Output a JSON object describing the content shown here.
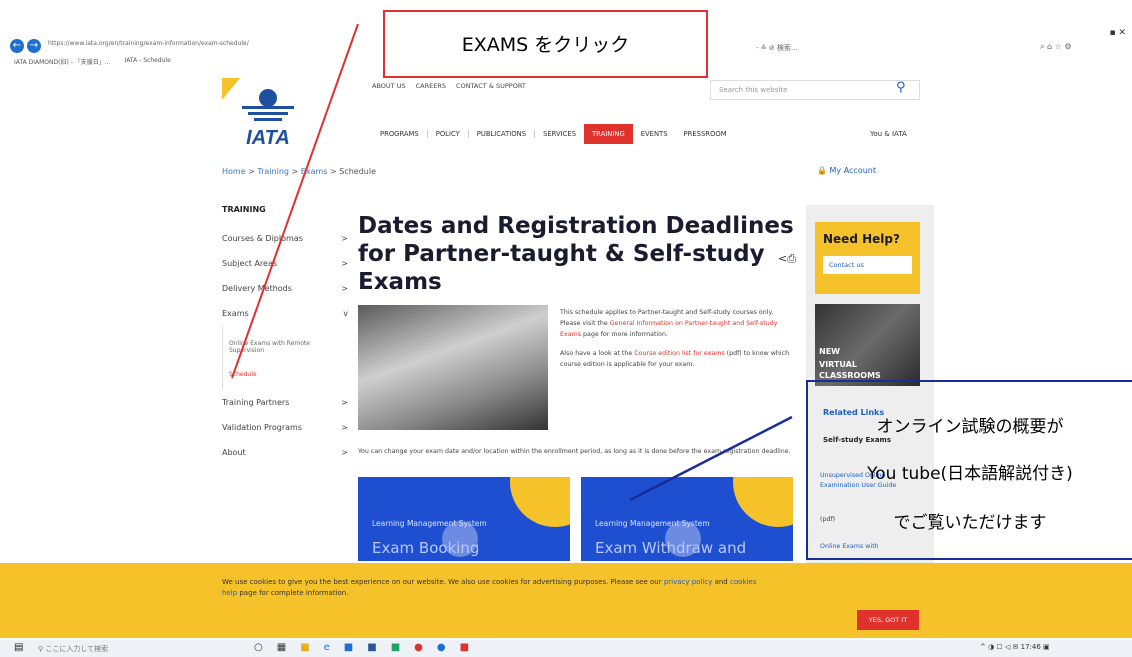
{
  "browser": {
    "url": "https://www.iata.org/en/training/exam-information/exam-schedule/",
    "tabs": [
      "IATA DIAMOND(旧) - 「支援日」...",
      "IATA - Schedule"
    ],
    "address_right": "- ≙ ⊘ 検索..."
  },
  "annotation": {
    "click_note": "EXAMS をクリック",
    "video_note": [
      "オンライン試験の概要が",
      "You tube(日本語解説付き)",
      "でご覧いただけます"
    ]
  },
  "header": {
    "top_links": [
      "ABOUT US",
      "CAREERS",
      "CONTACT & SUPPORT"
    ],
    "search_placeholder": "Search this website",
    "nav": [
      "PROGRAMS",
      "POLICY",
      "PUBLICATIONS",
      "SERVICES",
      "TRAINING",
      "EVENTS",
      "PRESSROOM"
    ],
    "you_iata": "You & IATA",
    "logo_text": "IATA"
  },
  "breadcrumb": {
    "home": "Home",
    "training": "Training",
    "exams": "Exams",
    "schedule": "Schedule",
    "sep": ">"
  },
  "my_account": "My Account",
  "sidebar": {
    "title": "TRAINING",
    "items": [
      {
        "label": "Courses & Diplomas",
        "chev": ">"
      },
      {
        "label": "Subject Areas",
        "chev": ">"
      },
      {
        "label": "Delivery Methods",
        "chev": ">"
      },
      {
        "label": "Exams",
        "chev": "v"
      }
    ],
    "sub": [
      "Online Exams with Remote Supervision",
      "Schedule"
    ],
    "items2": [
      {
        "label": "Training Partners",
        "chev": ">"
      },
      {
        "label": "Validation Programs",
        "chev": ">"
      },
      {
        "label": "About",
        "chev": ">"
      }
    ]
  },
  "main": {
    "title": "Dates and Registration Deadlines for Partner-taught & Self-study Exams",
    "intro1_a": "This schedule applies to Partner-taught and Self-study courses only. Please visit the ",
    "intro1_link": "General Information on Partner-taught and Self-study Exams",
    "intro1_b": " page for more information.",
    "intro2_a": "Also have a look at the ",
    "intro2_link": "Course edition list for exams",
    "intro2_b": " (pdf) to know which course edition is applicable for your exam.",
    "change": "You can change your exam date and/or location within the enrollment period, as long as it is done before the exam registration deadline.",
    "cards": [
      {
        "lms": "Learning Management System",
        "title": "Exam Booking"
      },
      {
        "lms": "Learning Management System",
        "title": "Exam Withdraw and"
      }
    ]
  },
  "right": {
    "help_title": "Need Help?",
    "contact": "Contact us",
    "new": "NEW",
    "virtual": "VIRTUAL CLASSROOMS",
    "related": "Related Links",
    "selfstudy": "Self-study Exams",
    "guide": "Unsupervised Online Examination User Guide",
    "pdf": "(pdf)",
    "online": "Online Exams with"
  },
  "cookie": {
    "text_a": "We use cookies to give you the best experience on our website. We also use cookies for advertising purposes. Please see our ",
    "privacy": "privacy policy",
    "and": " and ",
    "cookies": "cookies",
    "help": "help",
    "text_b": " page for complete information.",
    "button": "YES, GOT IT"
  },
  "taskbar": {
    "search": "ここに入力して検索",
    "time": "17:46"
  },
  "colors": {
    "accent": "#e0322d",
    "yellow": "#f5c22a",
    "blue": "#1f4fd1",
    "navy": "#1a2b9a"
  }
}
